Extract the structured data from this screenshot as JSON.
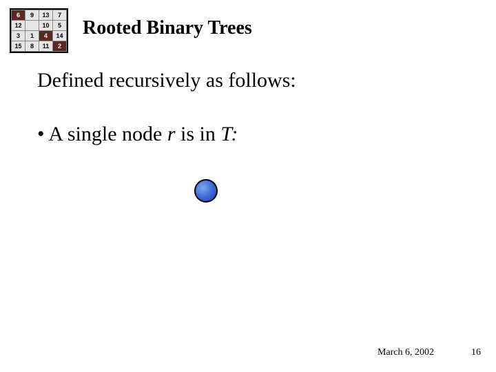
{
  "puzzle": {
    "rows": [
      [
        {
          "v": "6",
          "hi": true
        },
        {
          "v": "9",
          "hi": false
        },
        {
          "v": "13",
          "hi": false
        },
        {
          "v": "7",
          "hi": false
        }
      ],
      [
        {
          "v": "12",
          "hi": false
        },
        {
          "v": "",
          "hi": false
        },
        {
          "v": "10",
          "hi": false
        },
        {
          "v": "5",
          "hi": false
        }
      ],
      [
        {
          "v": "3",
          "hi": false
        },
        {
          "v": "1",
          "hi": false
        },
        {
          "v": "4",
          "hi": true
        },
        {
          "v": "14",
          "hi": false
        }
      ],
      [
        {
          "v": "15",
          "hi": false
        },
        {
          "v": "8",
          "hi": false
        },
        {
          "v": "11",
          "hi": false
        },
        {
          "v": "2",
          "hi": true
        }
      ]
    ]
  },
  "title": "Rooted Binary Trees",
  "definition": "Defined recursively as follows:",
  "bullet": {
    "prefix": "• A single node ",
    "r": "r",
    "mid": " is in ",
    "T": "T:"
  },
  "footer": {
    "date": "March 6, 2002",
    "page": "16"
  }
}
